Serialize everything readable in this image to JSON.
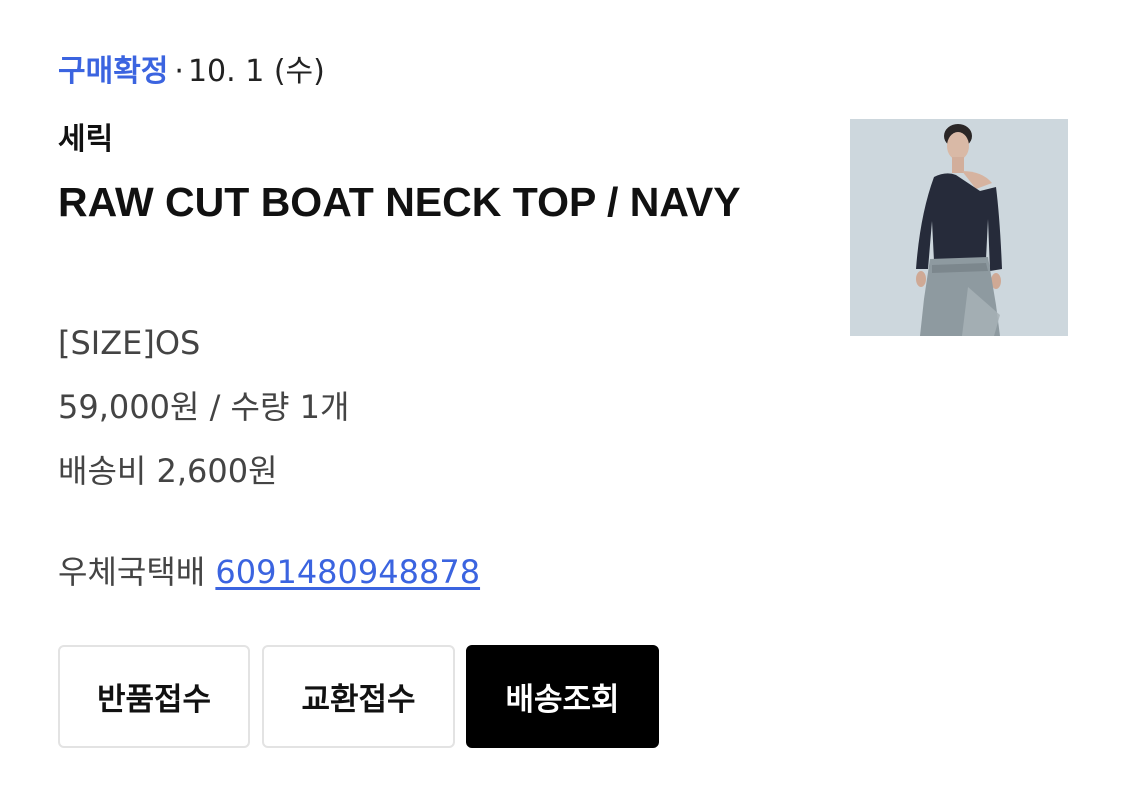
{
  "order": {
    "status": "구매확정",
    "separator": "·",
    "date": "10. 1 (수)"
  },
  "product": {
    "brand": "세릭",
    "name": "RAW CUT BOAT NECK TOP / NAVY",
    "option": "[SIZE]OS",
    "price_quantity": "59,000원 / 수량 1개",
    "shipping_fee": "배송비 2,600원"
  },
  "delivery": {
    "courier": "우체국택배",
    "tracking_number": "6091480948878"
  },
  "buttons": {
    "return": "반품접수",
    "exchange": "교환접수",
    "track": "배송조회"
  },
  "colors": {
    "accent": "#3b64e0",
    "primary_button_bg": "#000000",
    "secondary_button_border": "#e3e3e3"
  },
  "icons": {
    "thumbnail": "product-photo-model"
  }
}
